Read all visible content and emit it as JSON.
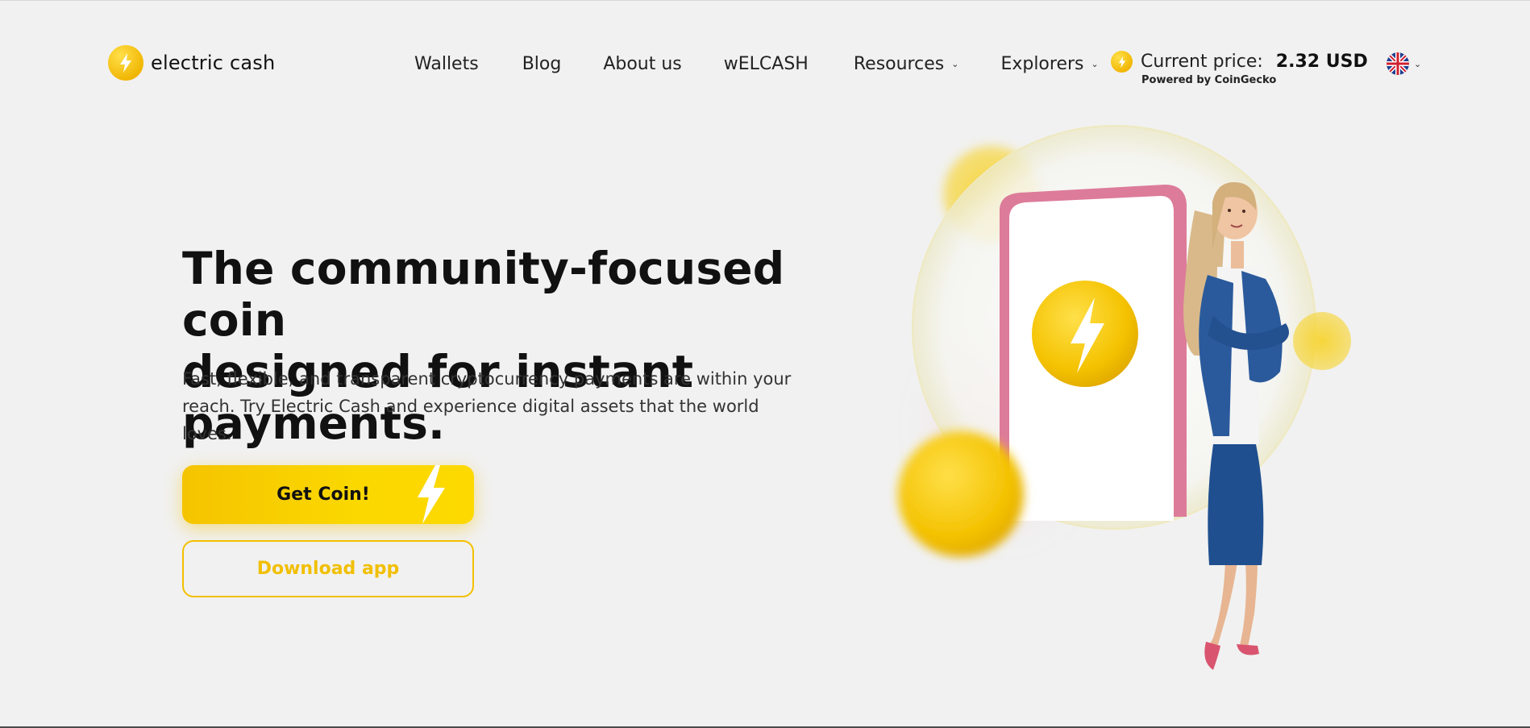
{
  "brand": {
    "name": "electric cash"
  },
  "nav": {
    "items": [
      {
        "label": "Wallets"
      },
      {
        "label": "Blog"
      },
      {
        "label": "About us"
      },
      {
        "label": "wELCASH"
      },
      {
        "label": "Resources",
        "dropdown": true
      },
      {
        "label": "Explorers",
        "dropdown": true
      }
    ]
  },
  "price": {
    "label": "Current price:",
    "value": "2.32 USD",
    "powered_by": "Powered by CoinGecko"
  },
  "language": {
    "icon": "uk-flag-icon"
  },
  "hero": {
    "title_line1": "The community-focused coin",
    "title_line2": "designed for instant payments.",
    "subtitle_line1": "Fast, flexible, and transparent cryptocurrency payments are within your",
    "subtitle_line2": "reach. Try Electric Cash and experience digital assets that the world loves.",
    "cta_primary": "Get Coin!",
    "cta_secondary": "Download app"
  },
  "colors": {
    "accent": "#f7c800",
    "background": "#f1f1f1",
    "text": "#111111",
    "figure_blue": "#1f4f8f",
    "phone_pink": "#e07a9a"
  }
}
